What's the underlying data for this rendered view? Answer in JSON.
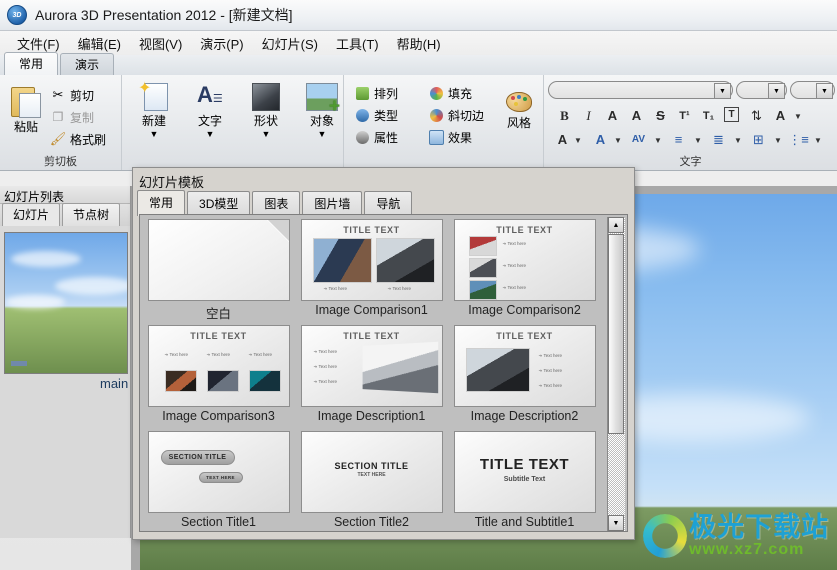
{
  "window": {
    "title": "Aurora 3D Presentation 2012 - [新建文档]",
    "app_icon": "aurora-3d-icon"
  },
  "menubar": {
    "items": [
      {
        "label": "文件(F)"
      },
      {
        "label": "编辑(E)"
      },
      {
        "label": "视图(V)"
      },
      {
        "label": "演示(P)"
      },
      {
        "label": "幻灯片(S)"
      },
      {
        "label": "工具(T)"
      },
      {
        "label": "帮助(H)"
      }
    ]
  },
  "ribbon": {
    "tabs": [
      {
        "label": "常用",
        "active": true
      },
      {
        "label": "演示",
        "active": false
      }
    ],
    "groups": [
      {
        "name": "clipboard",
        "label": "剪切板"
      },
      {
        "name": "insert",
        "label": ""
      },
      {
        "name": "style",
        "label": ""
      },
      {
        "name": "font",
        "label": "文字"
      }
    ],
    "clipboard": {
      "paste": "粘贴",
      "cut": "剪切",
      "copy": "复制",
      "format_painter": "格式刷"
    },
    "insert": {
      "new": "新建",
      "text": "文字",
      "shape": "形状",
      "object": "对象"
    },
    "style": {
      "arrange": "排列",
      "type": "类型",
      "property": "属性",
      "fill": "填充",
      "bevel": "斜切边",
      "effect": "效果",
      "style": "风格"
    },
    "font": {
      "family_value": "",
      "size_value": "",
      "extra_value": "",
      "row1": [
        "B",
        "I",
        "A",
        "A",
        "S",
        "T¹",
        "T₁",
        "T",
        "⇅",
        "A"
      ],
      "row2": [
        "A",
        "A",
        "AV",
        "≡",
        "≣",
        "⊞",
        "⋮≡"
      ]
    }
  },
  "left_panel": {
    "title": "幻灯片列表",
    "tabs": [
      {
        "label": "幻灯片",
        "active": true
      },
      {
        "label": "节点树",
        "active": false
      }
    ],
    "slide_label": "main"
  },
  "dialog": {
    "title": "幻灯片模板",
    "tabs": [
      {
        "label": "常用",
        "active": true
      },
      {
        "label": "3D模型",
        "active": false
      },
      {
        "label": "图表",
        "active": false
      },
      {
        "label": "图片墙",
        "active": false
      },
      {
        "label": "导航",
        "active": false
      }
    ],
    "scrollbar": {
      "up": "▲",
      "down": "▼"
    },
    "templates": [
      {
        "caption": "空白",
        "kind": "blank"
      },
      {
        "caption": "Image Comparison1",
        "kind": "comp1",
        "title": "TITLE TEXT",
        "bullets": [
          "Text here",
          "Text here"
        ]
      },
      {
        "caption": "Image Comparison2",
        "kind": "comp2",
        "title": "TITLE TEXT",
        "bullets": [
          "Text here",
          "Text here",
          "Text here"
        ]
      },
      {
        "caption": "Image Comparison3",
        "kind": "comp3",
        "title": "TITLE TEXT",
        "bullets": [
          "Text here",
          "Text here",
          "Text here"
        ]
      },
      {
        "caption": "Image Description1",
        "kind": "desc1",
        "title": "TITLE TEXT",
        "bullets": [
          "Text here",
          "Text here",
          "Text here"
        ]
      },
      {
        "caption": "Image Description2",
        "kind": "desc2",
        "title": "TITLE TEXT",
        "bullets": [
          "Text here",
          "Text here",
          "Text here"
        ]
      },
      {
        "caption": "Section Title1",
        "kind": "sect1",
        "title": "SECTION TITLE",
        "subtitle": "TEXT HERE"
      },
      {
        "caption": "Section Title2",
        "kind": "sect2",
        "title": "SECTION TITLE",
        "subtitle": "TEXT HERE"
      },
      {
        "caption": "Title and Subtitle1",
        "kind": "title1",
        "title": "TITLE TEXT",
        "subtitle": "Subtitle Text"
      }
    ]
  },
  "watermark": {
    "main": "极光下载站",
    "sub": "www.xz7.com"
  },
  "colors": {
    "accent": "#17a3df",
    "accent_green": "#6fbf2a",
    "sky": "#6ea9e9",
    "grass": "#5e7d48",
    "chrome": "#d6d3ce"
  }
}
